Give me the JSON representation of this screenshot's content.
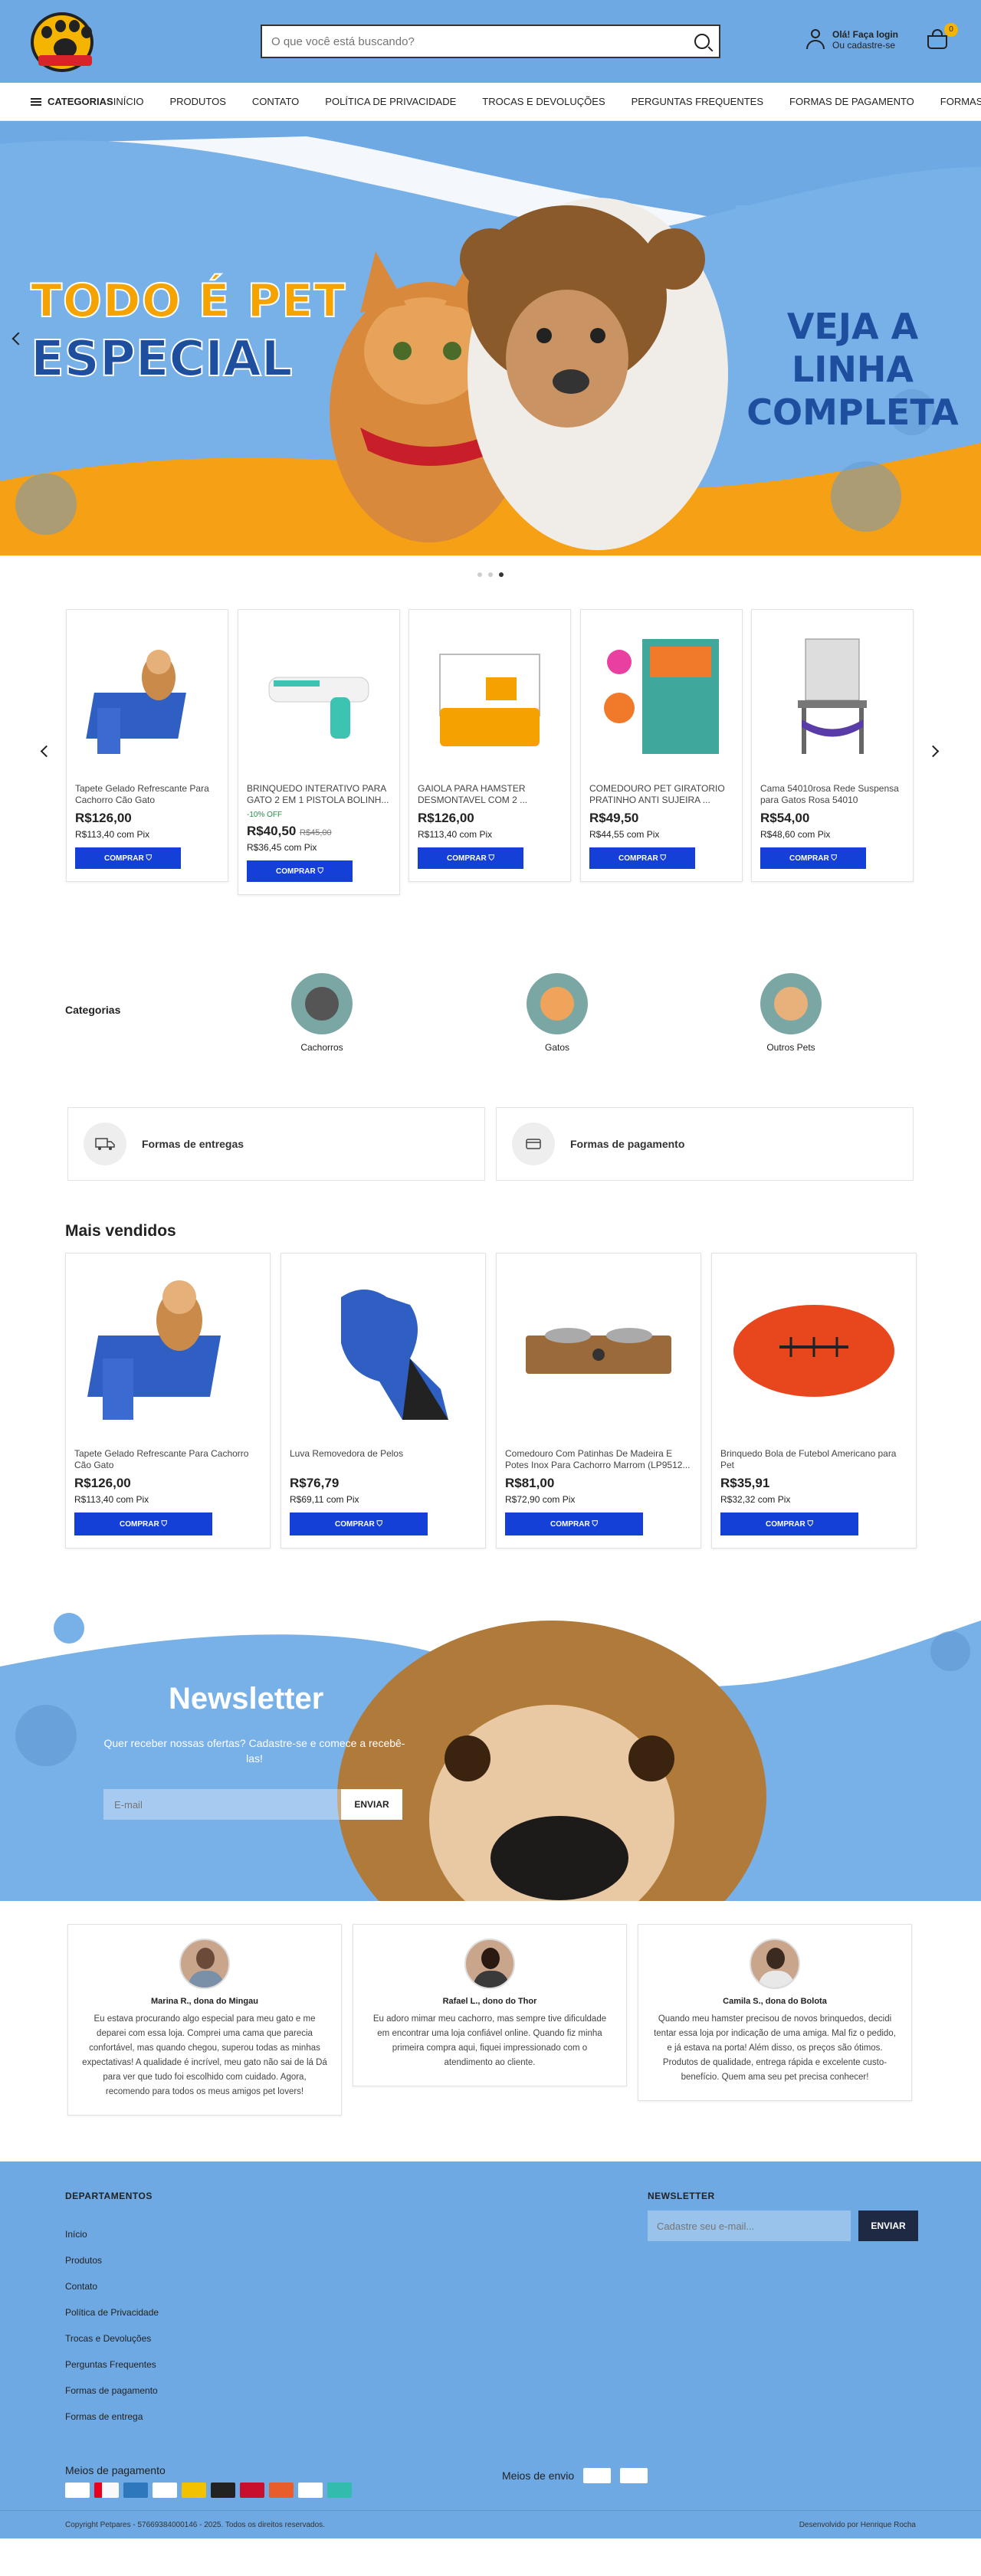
{
  "header": {
    "search_placeholder": "O que você está buscando?",
    "account_line1": "Olá! Faça login",
    "account_line2": "Ou cadastre-se",
    "cart_count": "0"
  },
  "nav": {
    "categories_label": "CATEGORIAS",
    "links": [
      "INÍCIO",
      "PRODUTOS",
      "CONTATO",
      "POLÍTICA DE PRIVACIDADE",
      "TROCAS E DEVOLUÇÕES",
      "PERGUNTAS FREQUENTES",
      "FORMAS DE PAGAMENTO",
      "FORMAS DE ENTREGA"
    ]
  },
  "hero": {
    "line1": "TODO É PET",
    "line2": "ESPECIAL",
    "cta_line1": "VEJA A LINHA",
    "cta_line2": "COMPLETA"
  },
  "carousel": {
    "products": [
      {
        "name": "Tapete Gelado Refrescante Para Cachorro Cão Gato",
        "discount": "",
        "price": "R$126,00",
        "old_price": "",
        "pix": "R$113,40 com Pix",
        "buy": "COMPRAR"
      },
      {
        "name": "BRINQUEDO INTERATIVO PARA GATO 2 EM 1 PISTOLA BOLINH...",
        "discount": "-10% OFF",
        "price": "R$40,50",
        "old_price": "R$45,00",
        "pix": "R$36,45 com Pix",
        "buy": "COMPRAR"
      },
      {
        "name": "GAIOLA PARA HAMSTER DESMONTAVEL COM 2 ...",
        "discount": "",
        "price": "R$126,00",
        "old_price": "",
        "pix": "R$113,40 com Pix",
        "buy": "COMPRAR"
      },
      {
        "name": "COMEDOURO PET GIRATORIO PRATINHO ANTI SUJEIRA ...",
        "discount": "",
        "price": "R$49,50",
        "old_price": "",
        "pix": "R$44,55 com Pix",
        "buy": "COMPRAR"
      },
      {
        "name": "Cama 54010rosa Rede Suspensa para Gatos Rosa 54010",
        "discount": "",
        "price": "R$54,00",
        "old_price": "",
        "pix": "R$48,60 com Pix",
        "buy": "COMPRAR"
      }
    ]
  },
  "categories": {
    "title": "Categorias",
    "items": [
      "Cachorros",
      "Gatos",
      "Outros Pets"
    ]
  },
  "info": {
    "shipping": "Formas de entregas",
    "payment": "Formas de pagamento"
  },
  "bestsellers": {
    "title": "Mais vendidos",
    "products": [
      {
        "name": "Tapete Gelado Refrescante Para Cachorro Cão Gato",
        "price": "R$126,00",
        "pix": "R$113,40 com Pix",
        "buy": "COMPRAR"
      },
      {
        "name": "Luva Removedora de Pelos",
        "price": "R$76,79",
        "pix": "R$69,11 com Pix",
        "buy": "COMPRAR"
      },
      {
        "name": "Comedouro Com Patinhas De Madeira E Potes Inox Para Cachorro Marrom (LP9512...",
        "price": "R$81,00",
        "pix": "R$72,90 com Pix",
        "buy": "COMPRAR"
      },
      {
        "name": "Brinquedo Bola de Futebol Americano para Pet",
        "price": "R$35,91",
        "pix": "R$32,32 com Pix",
        "buy": "COMPRAR"
      }
    ]
  },
  "newsletter": {
    "title": "Newsletter",
    "subtitle": "Quer receber nossas ofertas? Cadastre-se e comece a recebê-las!",
    "placeholder": "E-mail",
    "button": "ENVIAR"
  },
  "testimonials": [
    {
      "name": "Marina R., dona do Mingau",
      "text": "Eu estava procurando algo especial para meu gato e me deparei com essa loja. Comprei uma cama que parecia confortável, mas quando chegou, superou todas as minhas expectativas! A qualidade é incrível, meu gato não sai de lá Dá para ver que tudo foi escolhido com cuidado. Agora, recomendo para todos os meus amigos pet lovers!"
    },
    {
      "name": "Rafael L., dono do Thor",
      "text": "Eu adoro mimar meu cachorro, mas sempre tive dificuldade em encontrar uma loja confiável online. Quando fiz minha primeira compra aqui, fiquei impressionado com o atendimento ao cliente."
    },
    {
      "name": "Camila S., dona do Bolota",
      "text": "Quando meu hamster precisou de novos brinquedos, decidi tentar essa loja por indicação de uma amiga. Mal fiz o pedido, e já estava na porta! Além disso, os preços são ótimos. Produtos de qualidade, entrega rápida e excelente custo-benefício. Quem ama seu pet precisa conhecer!"
    }
  ],
  "footer": {
    "departments_title": "DEPARTAMENTOS",
    "departments": [
      "Início",
      "Produtos",
      "Contato",
      "Política de Privacidade",
      "Trocas e Devoluções",
      "Perguntas Frequentes",
      "Formas de pagamento",
      "Formas de entrega"
    ],
    "newsletter_title": "NEWSLETTER",
    "newsletter_placeholder": "Cadastre seu e-mail...",
    "newsletter_button": "ENVIAR",
    "payment_label": "Meios de pagamento",
    "shipping_label": "Meios de envio",
    "copyright": "Copyright Petpares - 57669384000146 - 2025. Todos os direitos reservados.",
    "credits": "Desenvolvido por Henrique Rocha"
  }
}
